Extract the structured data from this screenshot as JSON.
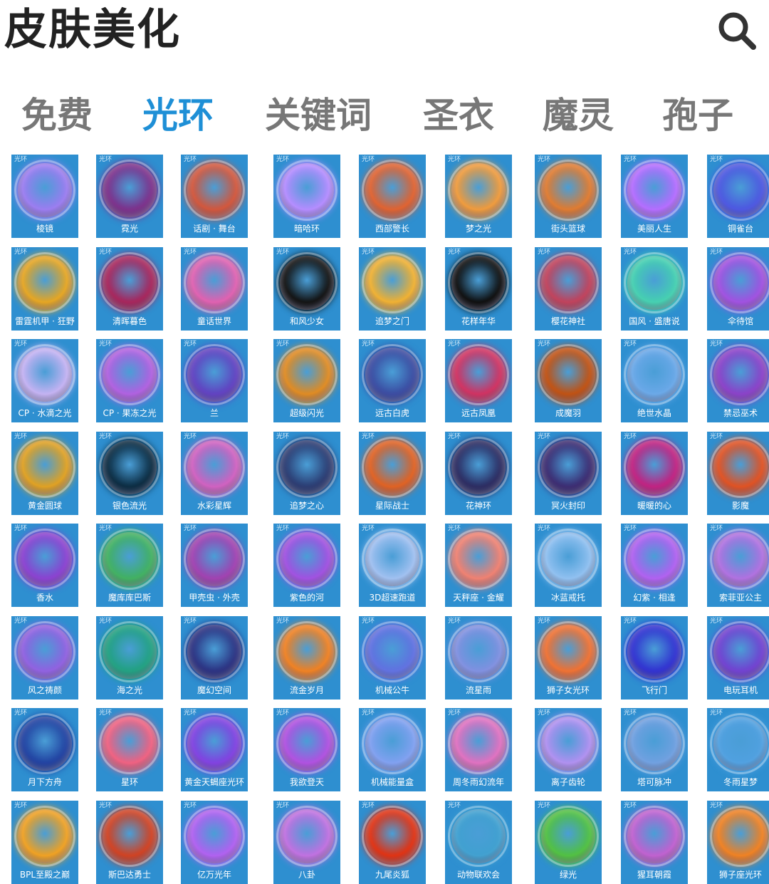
{
  "header": {
    "title": "皮肤美化"
  },
  "icons": {
    "search": "search-icon"
  },
  "tabs": [
    {
      "label": "免费",
      "active": false
    },
    {
      "label": "光环",
      "active": true
    },
    {
      "label": "关键词",
      "active": false
    },
    {
      "label": "圣衣",
      "active": false
    },
    {
      "label": "魔灵",
      "active": false
    },
    {
      "label": "孢子",
      "active": false
    }
  ],
  "colors": {
    "accent": "#1e8fd6",
    "tab_inactive": "#777777",
    "card_bg": "#2e8fd0",
    "title": "#222222"
  },
  "card_tag": "光环",
  "rows": [
    [
      {
        "name": "棱镜",
        "color": "#9b7cf0"
      },
      {
        "name": "霓光",
        "color": "#7b2f8a"
      },
      {
        "name": "话剧 · 舞台",
        "color": "#d2553a"
      },
      {
        "name": "暗哈环",
        "color": "#b48cff"
      },
      {
        "name": "西部警长",
        "color": "#e0612e"
      },
      {
        "name": "梦之光",
        "color": "#f09a3a"
      },
      {
        "name": "街头篮球",
        "color": "#e07a2e"
      },
      {
        "name": "美丽人生",
        "color": "#b46cff"
      },
      {
        "name": "铜雀台",
        "color": "#4c56e0"
      }
    ],
    [
      {
        "name": "雷霆机甲 · 狂野",
        "color": "#e6a520"
      },
      {
        "name": "清晖暮色",
        "color": "#a6235a"
      },
      {
        "name": "童话世界",
        "color": "#e060b0"
      },
      {
        "name": "和风少女",
        "color": "#111111"
      },
      {
        "name": "追梦之门",
        "color": "#f0b030"
      },
      {
        "name": "花样年华",
        "color": "#0d0d0d"
      },
      {
        "name": "樱花神社",
        "color": "#c0405a"
      },
      {
        "name": "国风 · 盛唐说",
        "color": "#45d0b0"
      },
      {
        "name": "伞待馆",
        "color": "#a050e0"
      }
    ],
    [
      {
        "name": "CP · 水滴之光",
        "color": "#c4b2f2"
      },
      {
        "name": "CP · 果冻之光",
        "color": "#b060e0"
      },
      {
        "name": "兰",
        "color": "#6040c0"
      },
      {
        "name": "超级闪光",
        "color": "#e08a20"
      },
      {
        "name": "远古白虎",
        "color": "#3a4aa0"
      },
      {
        "name": "远古凤凰",
        "color": "#d03060"
      },
      {
        "name": "成魔羽",
        "color": "#c05010"
      },
      {
        "name": "绝世水晶",
        "color": "#6aa8e8"
      },
      {
        "name": "禁忌巫术",
        "color": "#8a40c8"
      }
    ],
    [
      {
        "name": "黄金圆球",
        "color": "#e0a020"
      },
      {
        "name": "银色流光",
        "color": "#0a2a40"
      },
      {
        "name": "水彩星辉",
        "color": "#d060c0"
      },
      {
        "name": "追梦之心",
        "color": "#2a3a70"
      },
      {
        "name": "星际战士",
        "color": "#e06020"
      },
      {
        "name": "花神环",
        "color": "#2a2a60"
      },
      {
        "name": "冥火封印",
        "color": "#3a2a70"
      },
      {
        "name": "暖暖的心",
        "color": "#c02080"
      },
      {
        "name": "影魔",
        "color": "#e05020"
      }
    ],
    [
      {
        "name": "香水",
        "color": "#8a40d0"
      },
      {
        "name": "魔库库巴斯",
        "color": "#40b060"
      },
      {
        "name": "甲壳虫 · 外壳",
        "color": "#a040b0"
      },
      {
        "name": "紫色的河",
        "color": "#a050e0"
      },
      {
        "name": "3D超速跑道",
        "color": "#a0c0f0"
      },
      {
        "name": "天秤座 · 金耀",
        "color": "#f08070"
      },
      {
        "name": "冰蓝戒托",
        "color": "#90c0f0"
      },
      {
        "name": "幻紫 · 相逢",
        "color": "#b060f0"
      },
      {
        "name": "索菲亚公主",
        "color": "#b070e0"
      }
    ],
    [
      {
        "name": "风之祷颜",
        "color": "#9060e0"
      },
      {
        "name": "海之光",
        "color": "#20a080"
      },
      {
        "name": "魔幻空间",
        "color": "#2a3080"
      },
      {
        "name": "流金岁月",
        "color": "#f08020"
      },
      {
        "name": "机械公牛",
        "color": "#6070e0"
      },
      {
        "name": "流星雨",
        "color": "#8090e0"
      },
      {
        "name": "狮子女光环",
        "color": "#f07030"
      },
      {
        "name": "飞行门",
        "color": "#3030d0"
      },
      {
        "name": "电玩耳机",
        "color": "#7040d0"
      }
    ],
    [
      {
        "name": "月下方舟",
        "color": "#2040a0"
      },
      {
        "name": "星环",
        "color": "#f06080"
      },
      {
        "name": "黄金天蝎座光环",
        "color": "#8040e0"
      },
      {
        "name": "我欲登天",
        "color": "#b050e0"
      },
      {
        "name": "机械能量盒",
        "color": "#80a0f0"
      },
      {
        "name": "周冬雨幻流年",
        "color": "#e070c0"
      },
      {
        "name": "离子齿轮",
        "color": "#b090f0"
      },
      {
        "name": "塔可脉冲",
        "color": "#70a0e0"
      },
      {
        "name": "冬雨星梦",
        "color": "#50a0e0"
      }
    ],
    [
      {
        "name": "BPL至殿之巅",
        "color": "#f0a020"
      },
      {
        "name": "斯巴达勇士",
        "color": "#d04020"
      },
      {
        "name": "亿万光年",
        "color": "#b060f0"
      },
      {
        "name": "八卦",
        "color": "#c070e0"
      },
      {
        "name": "九尾炎狐",
        "color": "#e03010"
      },
      {
        "name": "动物联欢会",
        "color": "#40a0d0"
      },
      {
        "name": "绿光",
        "color": "#50c040"
      },
      {
        "name": "猩耳朝霞",
        "color": "#c060d0"
      },
      {
        "name": "狮子座光环",
        "color": "#f08020"
      }
    ]
  ]
}
